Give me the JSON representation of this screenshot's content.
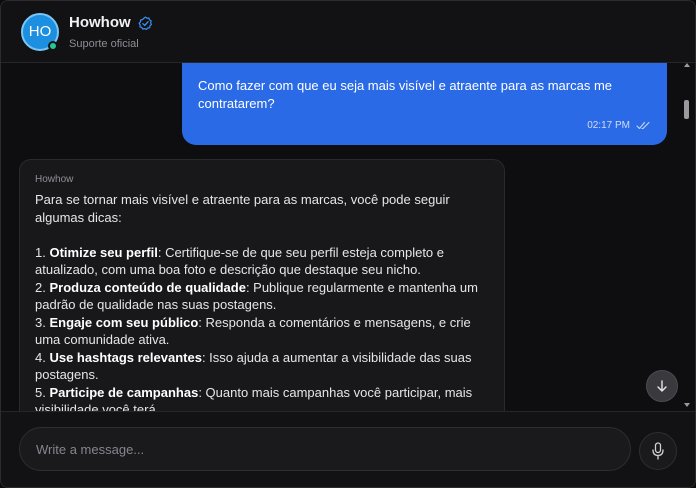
{
  "header": {
    "avatar_initials": "HO",
    "contact_name": "Howhow",
    "status": "Suporte oficial",
    "verified_icon": "verified-check-icon"
  },
  "conversation": {
    "user_message": {
      "text": "Como fazer com que eu seja mais visível e atraente para as marcas me contratarem?",
      "time": "02:17 PM",
      "status_icon": "double-check-icon"
    },
    "bot_message": {
      "sender": "Howhow",
      "intro": "Para se tornar mais visível e atraente para as marcas, você pode seguir algumas dicas:",
      "tips": [
        {
          "num": "1.",
          "title": "Otimize seu perfil",
          "body": ": Certifique-se de que seu perfil esteja completo e atualizado, com uma boa foto e descrição que destaque seu nicho."
        },
        {
          "num": "2.",
          "title": "Produza conteúdo de qualidade",
          "body": ": Publique regularmente e mantenha um padrão de qualidade nas suas postagens."
        },
        {
          "num": "3.",
          "title": "Engaje com seu público",
          "body": ": Responda a comentários e mensagens, e crie uma comunidade ativa."
        },
        {
          "num": "4.",
          "title": "Use hashtags relevantes",
          "body": ": Isso ajuda a aumentar a visibilidade das suas postagens."
        },
        {
          "num": "5.",
          "title": "Participe de campanhas",
          "body": ": Quanto mais campanhas você participar, mais visibilidade você terá."
        }
      ]
    }
  },
  "composer": {
    "placeholder": "Write a message...",
    "mic_icon": "microphone-icon"
  },
  "colors": {
    "user_bubble": "#2a6ae6",
    "bot_bubble": "#18181b",
    "background": "#0e0e10",
    "avatar": "#1d8fe0",
    "online": "#20c997"
  }
}
